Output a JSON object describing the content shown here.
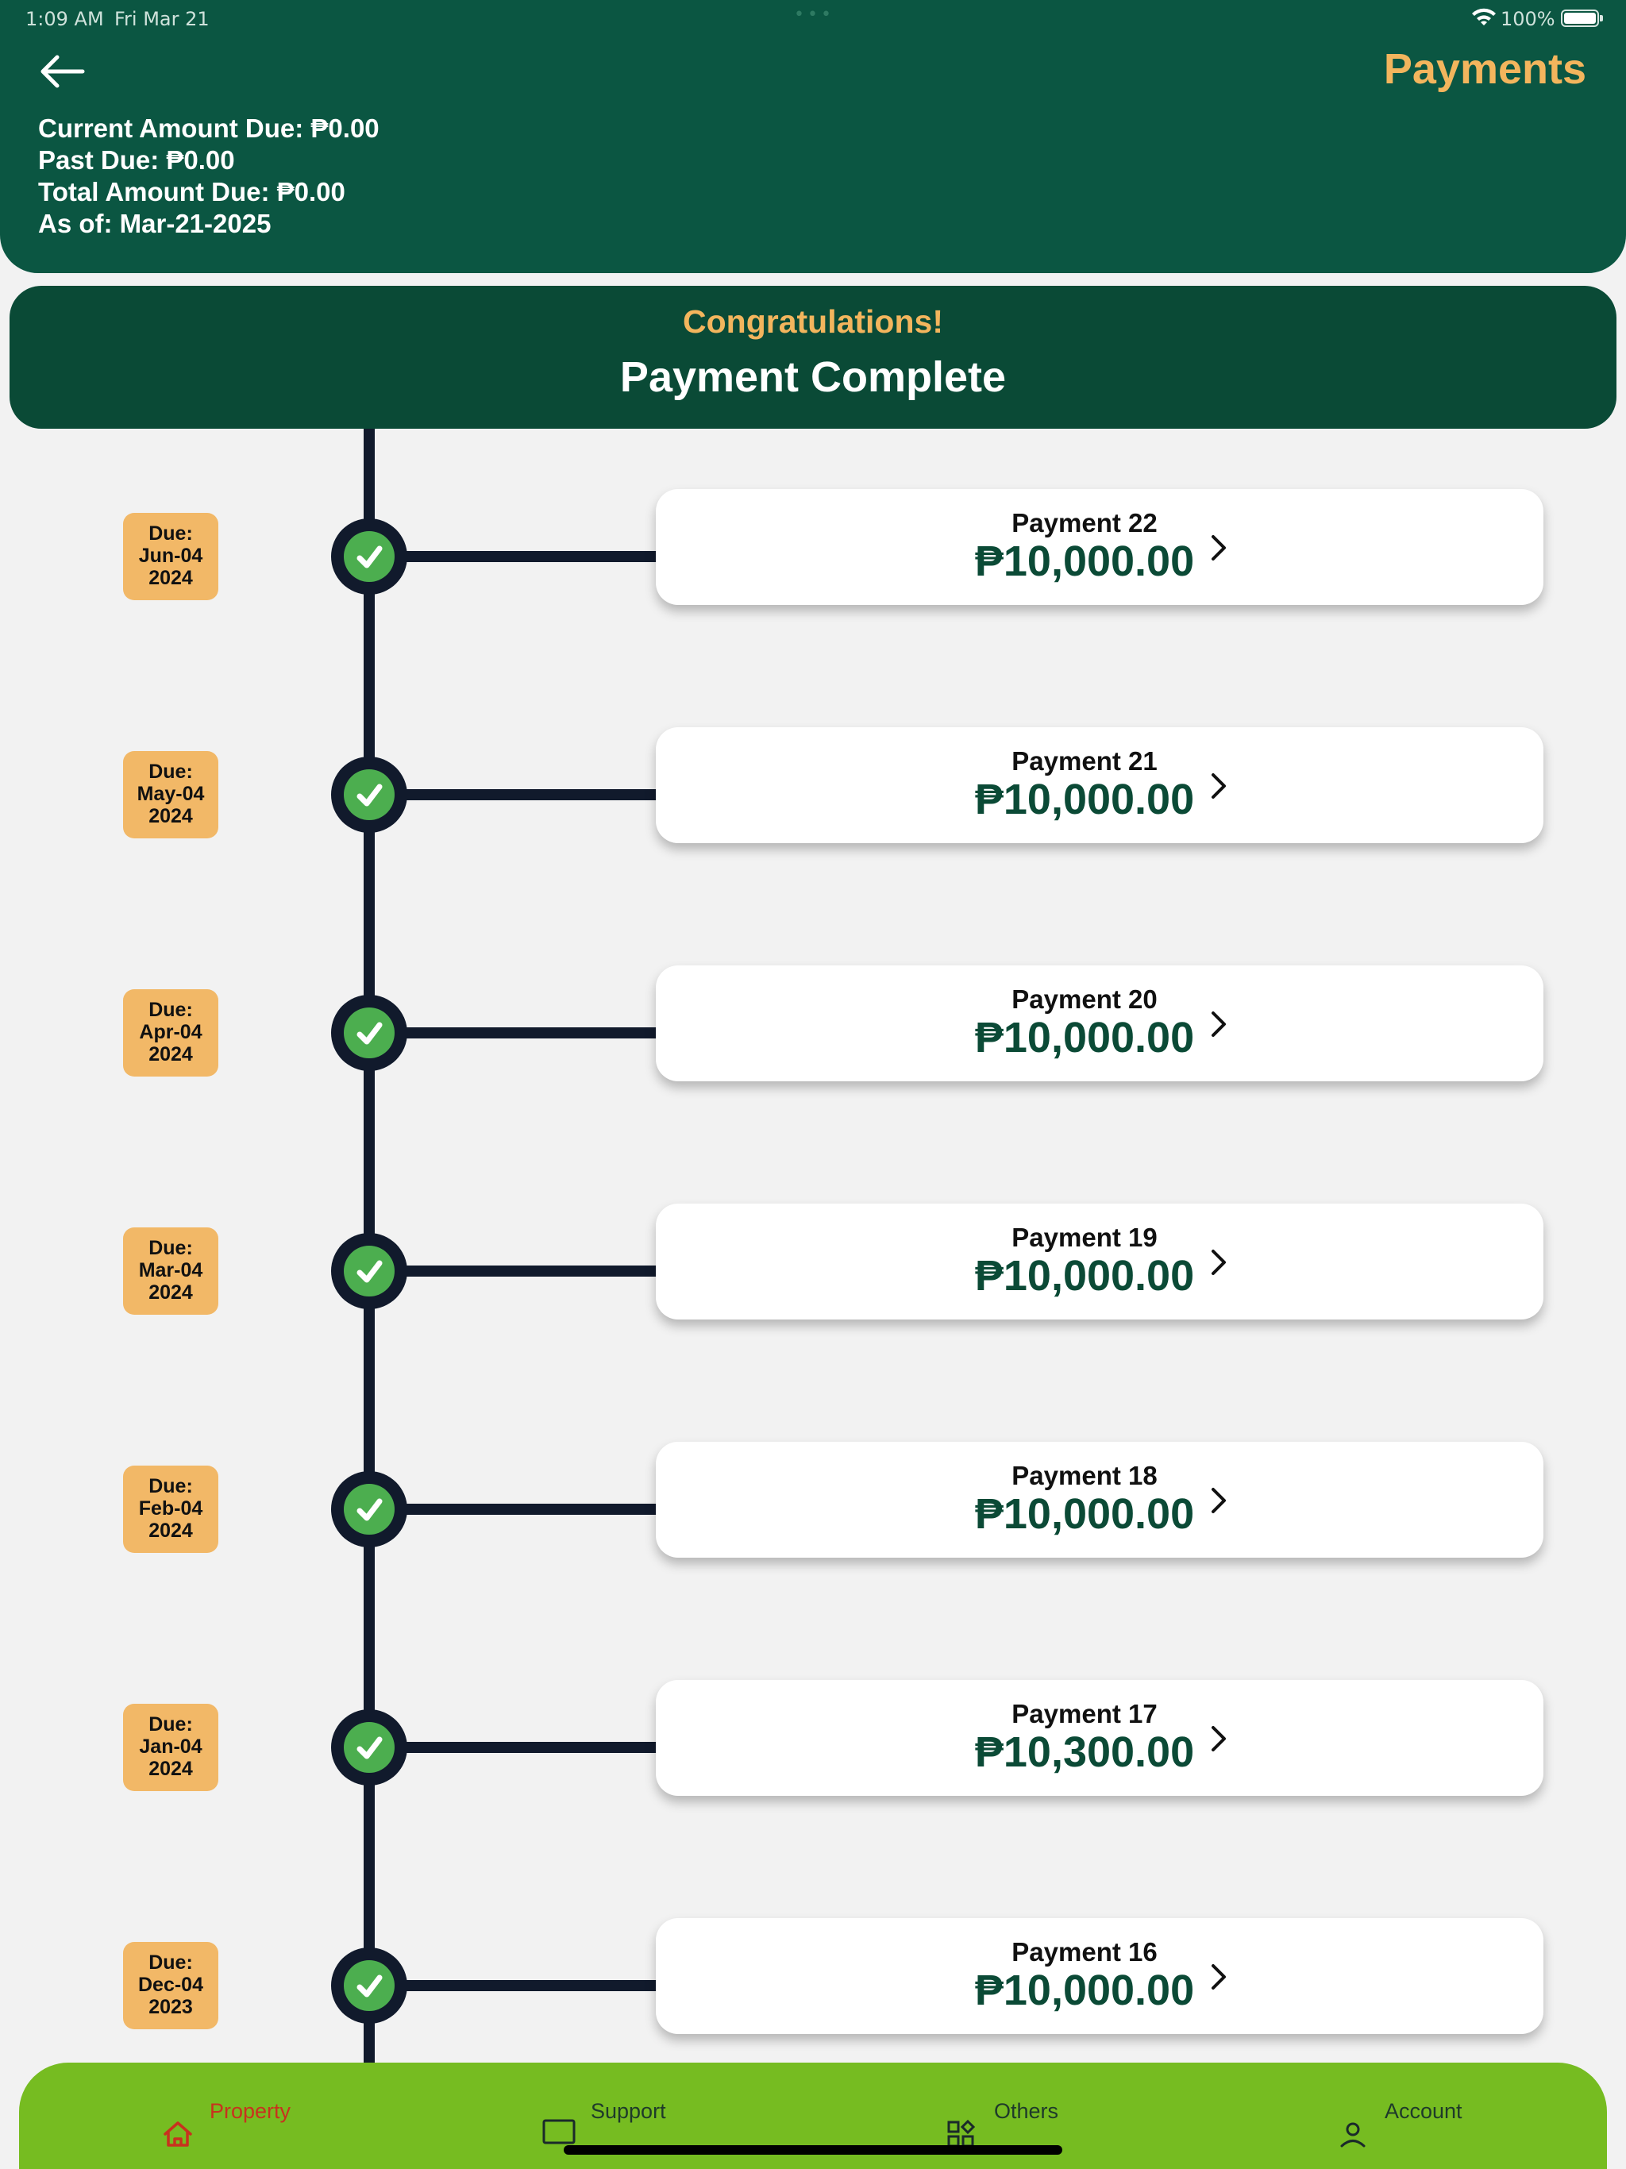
{
  "status_bar": {
    "time": "1:09 AM",
    "date": "Fri Mar 21",
    "battery": "100%"
  },
  "header": {
    "title": "Payments",
    "summary": {
      "current_amount_due": "Current Amount Due:  ₱0.00",
      "past_due": "Past Due:  ₱0.00",
      "total_amount_due": "Total Amount Due:  ₱0.00",
      "as_of": "As of: Mar-21-2025"
    }
  },
  "banner": {
    "congrats": "Congratulations!",
    "status": "Payment Complete"
  },
  "payments": [
    {
      "due_label": "Due:",
      "due_date": "Jun-04",
      "due_year": "2024",
      "label": "Payment 22",
      "amount": "₱10,000.00"
    },
    {
      "due_label": "Due:",
      "due_date": "May-04",
      "due_year": "2024",
      "label": "Payment 21",
      "amount": "₱10,000.00"
    },
    {
      "due_label": "Due:",
      "due_date": "Apr-04",
      "due_year": "2024",
      "label": "Payment 20",
      "amount": "₱10,000.00"
    },
    {
      "due_label": "Due:",
      "due_date": "Mar-04",
      "due_year": "2024",
      "label": "Payment 19",
      "amount": "₱10,000.00"
    },
    {
      "due_label": "Due:",
      "due_date": "Feb-04",
      "due_year": "2024",
      "label": "Payment 18",
      "amount": "₱10,000.00"
    },
    {
      "due_label": "Due:",
      "due_date": "Jan-04",
      "due_year": "2024",
      "label": "Payment 17",
      "amount": "₱10,300.00"
    },
    {
      "due_label": "Due:",
      "due_date": "Dec-04",
      "due_year": "2023",
      "label": "Payment 16",
      "amount": "₱10,000.00"
    }
  ],
  "bottom_nav": {
    "items": [
      {
        "label": "Property",
        "icon": "home-icon",
        "active": true
      },
      {
        "label": "Support",
        "icon": "laptop-icon",
        "active": false
      },
      {
        "label": "Others",
        "icon": "grid-icon",
        "active": false
      },
      {
        "label": "Account",
        "icon": "user-icon",
        "active": false
      }
    ]
  },
  "colors": {
    "header_bg": "#0b5642",
    "accent_gold": "#f3b55d",
    "nav_bg": "#76bc21",
    "active_nav": "#c8321e",
    "check_green": "#4cae4f"
  }
}
